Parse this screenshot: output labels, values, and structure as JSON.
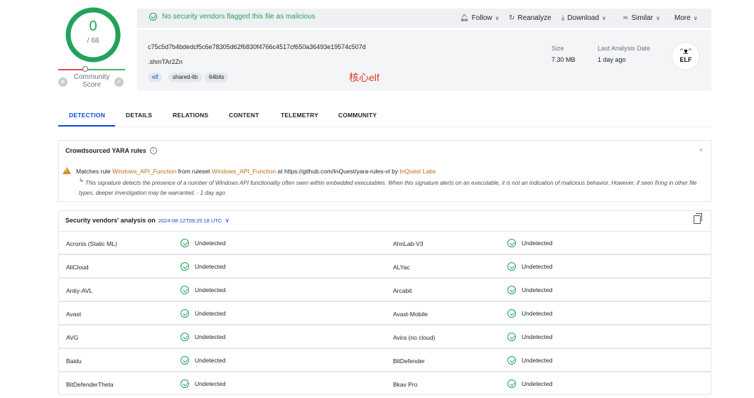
{
  "score": {
    "detections": "0",
    "total": "/ 68",
    "community_label": "Community Score"
  },
  "banner": {
    "message": "No security vendors flagged this file as malicious"
  },
  "actions": {
    "follow": "Follow",
    "reanalyze": "Reanalyze",
    "download": "Download",
    "similar": "Similar",
    "more": "More"
  },
  "file": {
    "hash": "c75c5d7b4bdedcf5c6e78305d62f6830f4766c4517cf650a36493e19574c507d",
    "name": ".shmTAr2Zn",
    "tags": [
      "elf",
      "shared-lib",
      "64bits"
    ],
    "size_label": "Size",
    "size_value": "7.30 MB",
    "last_analysis_label": "Last Analysis Date",
    "last_analysis_value": "1 day ago",
    "type_badge": "ELF"
  },
  "annotation": "核心elf",
  "tabs": [
    "DETECTION",
    "DETAILS",
    "RELATIONS",
    "CONTENT",
    "TELEMETRY",
    "COMMUNITY"
  ],
  "yara": {
    "title": "Crowdsourced YARA rules",
    "prefix": "Matches rule",
    "rule": "Windows_API_Function",
    "from": "from ruleset",
    "ruleset": "Windows_API_Function",
    "at": "at https://github.com/InQuest/yara-rules-vt by",
    "author": "InQuest Labs",
    "description": "This signature detects the presence of a number of Windows API functionality often seen within embedded executables. When this signature alerts on an executable, it is not an indication of malicious behavior. However, if seen firing in other file types, deeper investigation may be warranted. - 1 day ago"
  },
  "vendors": {
    "title": "Security vendors' analysis on",
    "date": "2024-08-12T09:25:18 UTC",
    "rows": [
      [
        {
          "name": "Acronis (Static ML)",
          "result": "Undetected"
        },
        {
          "name": "AhnLab-V3",
          "result": "Undetected"
        }
      ],
      [
        {
          "name": "AliCloud",
          "result": "Undetected"
        },
        {
          "name": "ALYac",
          "result": "Undetected"
        }
      ],
      [
        {
          "name": "Antiy-AVL",
          "result": "Undetected"
        },
        {
          "name": "Arcabit",
          "result": "Undetected"
        }
      ],
      [
        {
          "name": "Avast",
          "result": "Undetected"
        },
        {
          "name": "Avast-Mobile",
          "result": "Undetected"
        }
      ],
      [
        {
          "name": "AVG",
          "result": "Undetected"
        },
        {
          "name": "Avira (no cloud)",
          "result": "Undetected"
        }
      ],
      [
        {
          "name": "Baidu",
          "result": "Undetected"
        },
        {
          "name": "BitDefender",
          "result": "Undetected"
        }
      ],
      [
        {
          "name": "BitDefenderTheta",
          "result": "Undetected"
        },
        {
          "name": "Bkav Pro",
          "result": "Undetected"
        }
      ]
    ]
  },
  "colors": {
    "accent": "#0b4dda",
    "clean": "#20a35b",
    "warning": "#d9891f",
    "annotation": "#e0362a"
  }
}
